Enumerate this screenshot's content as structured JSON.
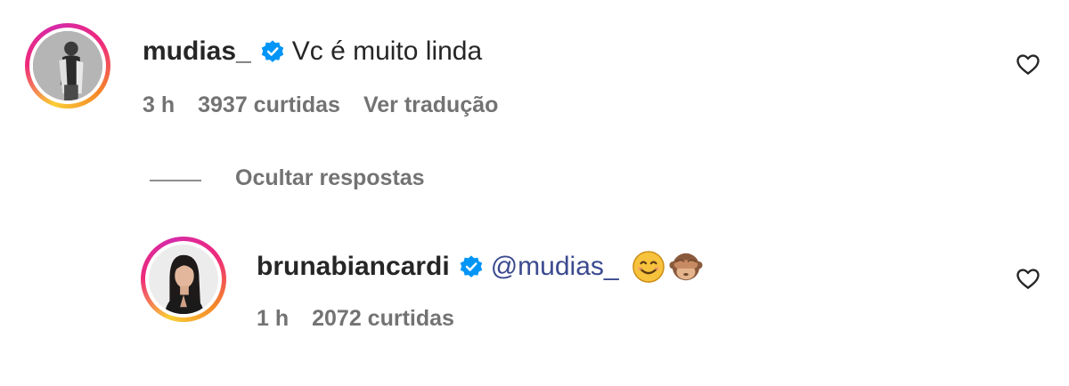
{
  "comment": {
    "username": "mudias_",
    "verified": true,
    "text": "Vc é muito linda",
    "time": "3 h",
    "likes": "3937 curtidas",
    "translate_label": "Ver tradução",
    "avatar_icon": "user-photo-avatar",
    "like_icon": "heart-outline-icon"
  },
  "replies_toggle": {
    "label": "Ocultar respostas"
  },
  "reply": {
    "username": "brunabiancardi",
    "verified": true,
    "mention": "@mudias_",
    "emojis": [
      "smiling-face-emoji",
      "see-no-evil-monkey-emoji"
    ],
    "time": "1 h",
    "likes": "2072 curtidas",
    "avatar_icon": "user-photo-avatar",
    "like_icon": "heart-outline-icon"
  },
  "colors": {
    "verified_blue": "#0095f6",
    "mention_blue": "#3b4a8f",
    "meta_gray": "#737373",
    "text_dark": "#262626"
  }
}
